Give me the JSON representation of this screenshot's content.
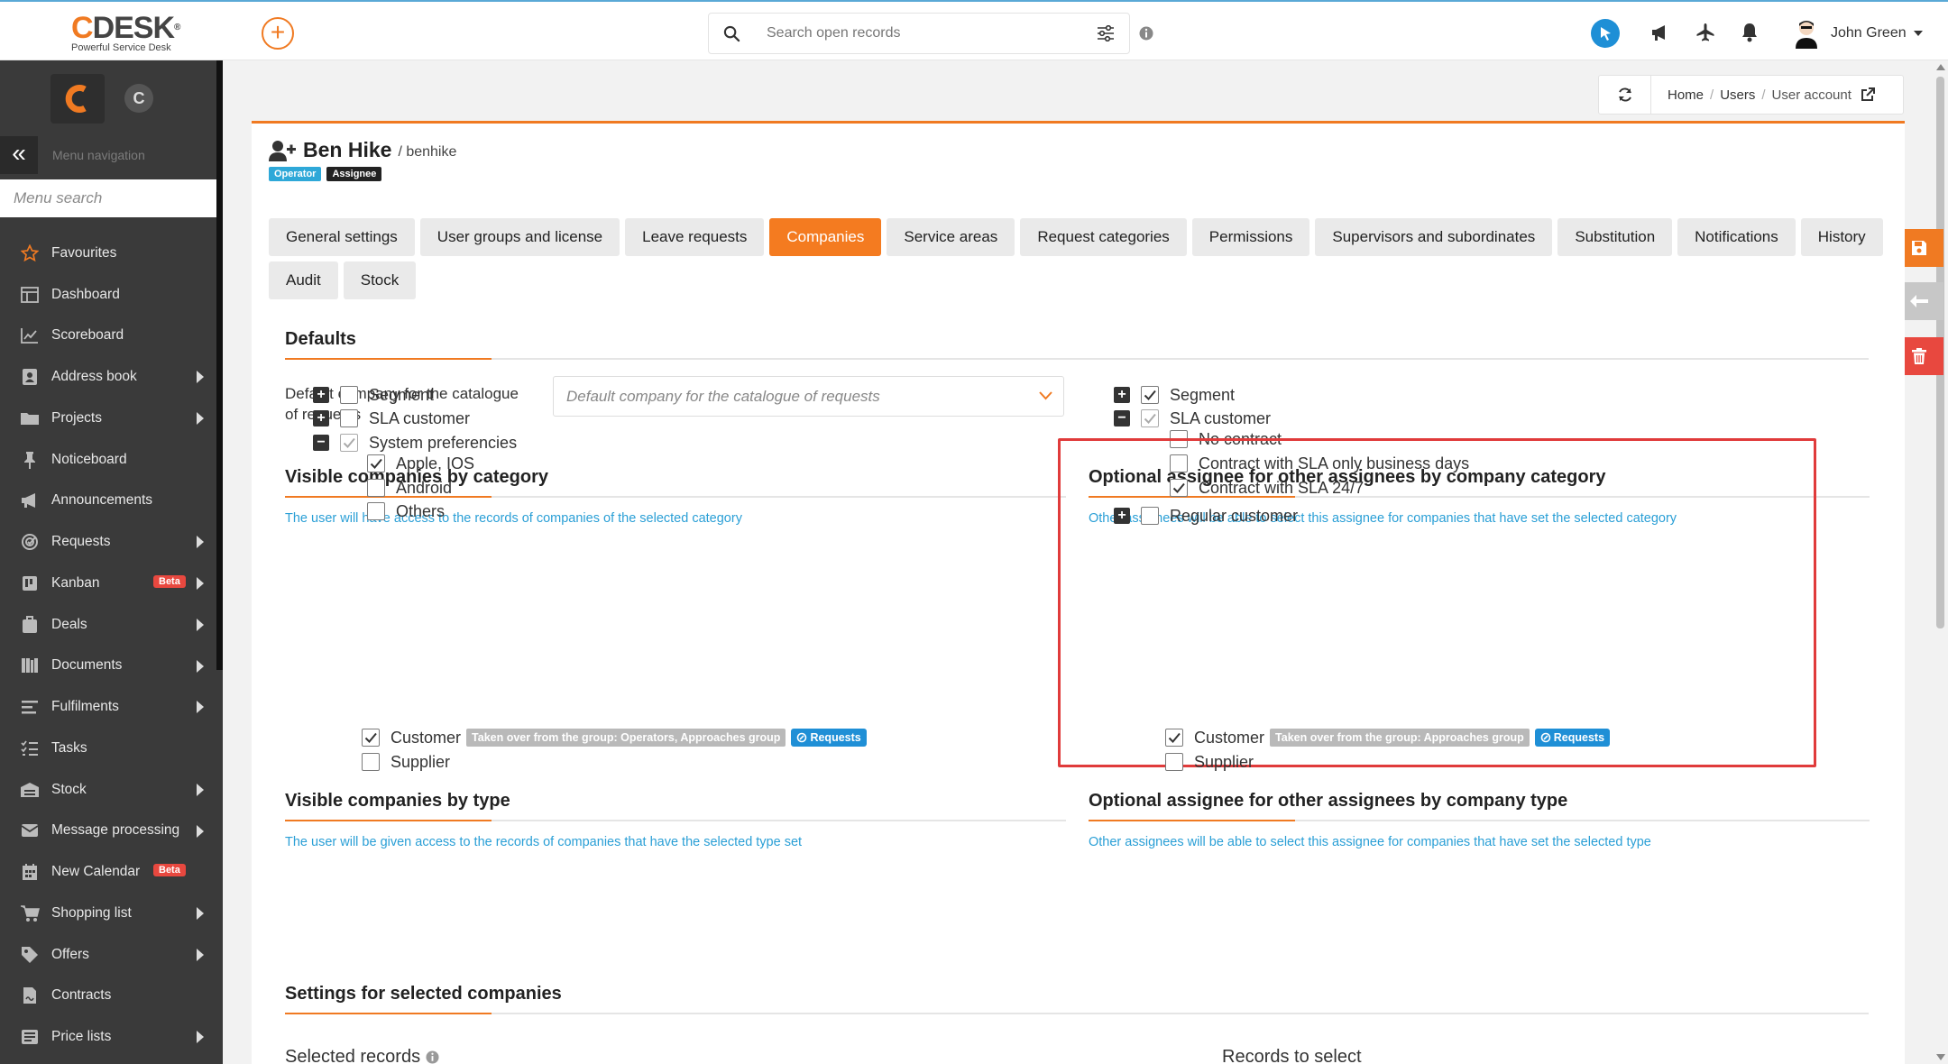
{
  "app": {
    "logo_text": "DESK",
    "logo_c": "C",
    "logo_sub": "Powerful Service Desk",
    "search_placeholder": "Search open records",
    "user_name": "John Green"
  },
  "sidebar": {
    "nav_label": "Menu navigation",
    "search_placeholder": "Menu search",
    "logo_letter": "C",
    "items": [
      {
        "label": "Favourites",
        "icon": "star-icon",
        "arrow": false
      },
      {
        "label": "Dashboard",
        "icon": "dashboard-icon",
        "arrow": false
      },
      {
        "label": "Scoreboard",
        "icon": "chart-line-icon",
        "arrow": false
      },
      {
        "label": "Address book",
        "icon": "address-book-icon",
        "arrow": true
      },
      {
        "label": "Projects",
        "icon": "folder-icon",
        "arrow": true
      },
      {
        "label": "Noticeboard",
        "icon": "pin-icon",
        "arrow": false
      },
      {
        "label": "Announcements",
        "icon": "megaphone-icon",
        "arrow": false
      },
      {
        "label": "Requests",
        "icon": "target-icon",
        "arrow": true
      },
      {
        "label": "Kanban",
        "icon": "kanban-icon",
        "arrow": true,
        "badge": "Beta"
      },
      {
        "label": "Deals",
        "icon": "briefcase-icon",
        "arrow": true
      },
      {
        "label": "Documents",
        "icon": "books-icon",
        "arrow": true
      },
      {
        "label": "Fulfilments",
        "icon": "lines-icon",
        "arrow": true
      },
      {
        "label": "Tasks",
        "icon": "tasks-icon",
        "arrow": false
      },
      {
        "label": "Stock",
        "icon": "warehouse-icon",
        "arrow": true
      },
      {
        "label": "Message processing",
        "icon": "envelope-icon",
        "arrow": true
      },
      {
        "label": "New Calendar",
        "icon": "calendar-icon",
        "arrow": false,
        "badge": "Beta"
      },
      {
        "label": "Shopping list",
        "icon": "cart-icon",
        "arrow": true
      },
      {
        "label": "Offers",
        "icon": "tag-icon",
        "arrow": true
      },
      {
        "label": "Contracts",
        "icon": "contract-icon",
        "arrow": false
      },
      {
        "label": "Price lists",
        "icon": "price-list-icon",
        "arrow": true
      }
    ]
  },
  "breadcrumb": {
    "home": "Home",
    "users": "Users",
    "current": "User account"
  },
  "user": {
    "full_name": "Ben Hike",
    "login": "/ benhike",
    "badges": [
      {
        "label": "Operator",
        "color": "#2ea8d8"
      },
      {
        "label": "Assignee",
        "color": "#222222"
      }
    ]
  },
  "tabs": [
    {
      "label": "General settings",
      "active": false
    },
    {
      "label": "User groups and license",
      "active": false
    },
    {
      "label": "Leave requests",
      "active": false
    },
    {
      "label": "Companies",
      "active": true
    },
    {
      "label": "Service areas",
      "active": false
    },
    {
      "label": "Request categories",
      "active": false
    },
    {
      "label": "Permissions",
      "active": false
    },
    {
      "label": "Supervisors and subordinates",
      "active": false
    },
    {
      "label": "Substitution",
      "active": false
    },
    {
      "label": "Notifications",
      "active": false
    },
    {
      "label": "History",
      "active": false
    },
    {
      "label": "Audit",
      "active": false
    },
    {
      "label": "Stock",
      "active": false
    }
  ],
  "defaults": {
    "title": "Defaults",
    "label": "Default company for the catalogue of requests",
    "placeholder": "Default company for the catalogue of requests"
  },
  "visible_by_category": {
    "title": "Visible companies by category",
    "hint": "The user will have access to the records of companies of the selected category",
    "rows": [
      {
        "label": "Segment",
        "toggle": "+",
        "checked": "no",
        "level": 0
      },
      {
        "label": "SLA customer",
        "toggle": "+",
        "checked": "no",
        "level": 0
      },
      {
        "label": "System preferencies",
        "toggle": "-",
        "checked": "partial",
        "level": 0
      },
      {
        "label": "Apple, IOS",
        "toggle": "",
        "checked": "yes",
        "level": 1
      },
      {
        "label": "Android",
        "toggle": "",
        "checked": "no",
        "level": 1
      },
      {
        "label": "Others",
        "toggle": "",
        "checked": "no",
        "level": 1
      }
    ]
  },
  "optional_by_category": {
    "title": "Optional assignee for other assignees by company category",
    "hint": "Other assignees will be able to select this assignee for companies that have set the selected category",
    "rows": [
      {
        "label": "Segment",
        "toggle": "+",
        "checked": "yes",
        "level": 0
      },
      {
        "label": "SLA customer",
        "toggle": "-",
        "checked": "partial",
        "level": 0
      },
      {
        "label": "No contract",
        "toggle": "",
        "checked": "no",
        "level": 1
      },
      {
        "label": "Contract with SLA only business days",
        "toggle": "",
        "checked": "no",
        "level": 1
      },
      {
        "label": "Contract with SLA 24/7",
        "toggle": "",
        "checked": "yes",
        "level": 1
      },
      {
        "label": "Regular customer",
        "toggle": "+",
        "checked": "no",
        "level": 0
      }
    ]
  },
  "visible_by_type": {
    "title": "Visible companies by type",
    "hint": "The user will be given access to the records of companies that have the selected type set",
    "rows": [
      {
        "label": "Customer",
        "checked": "yes",
        "inherited": "Taken over from the group: Operators, Approaches group",
        "module": "Requests"
      },
      {
        "label": "Supplier",
        "checked": "no"
      }
    ]
  },
  "optional_by_type": {
    "title": "Optional assignee for other assignees by company type",
    "hint": "Other assignees will be able to select this assignee for companies that have set the selected type",
    "rows": [
      {
        "label": "Customer",
        "checked": "yes",
        "inherited": "Taken over from the group: Approaches group",
        "module": "Requests"
      },
      {
        "label": "Supplier",
        "checked": "no"
      }
    ]
  },
  "selected_companies": {
    "title": "Settings for selected companies",
    "selected_records": "Selected records",
    "records_to_select": "Records to select"
  },
  "colors": {
    "accent": "#f07a22",
    "link": "#2a9fd6",
    "highlight": "#e03b3b",
    "delete": "#e8483f"
  }
}
